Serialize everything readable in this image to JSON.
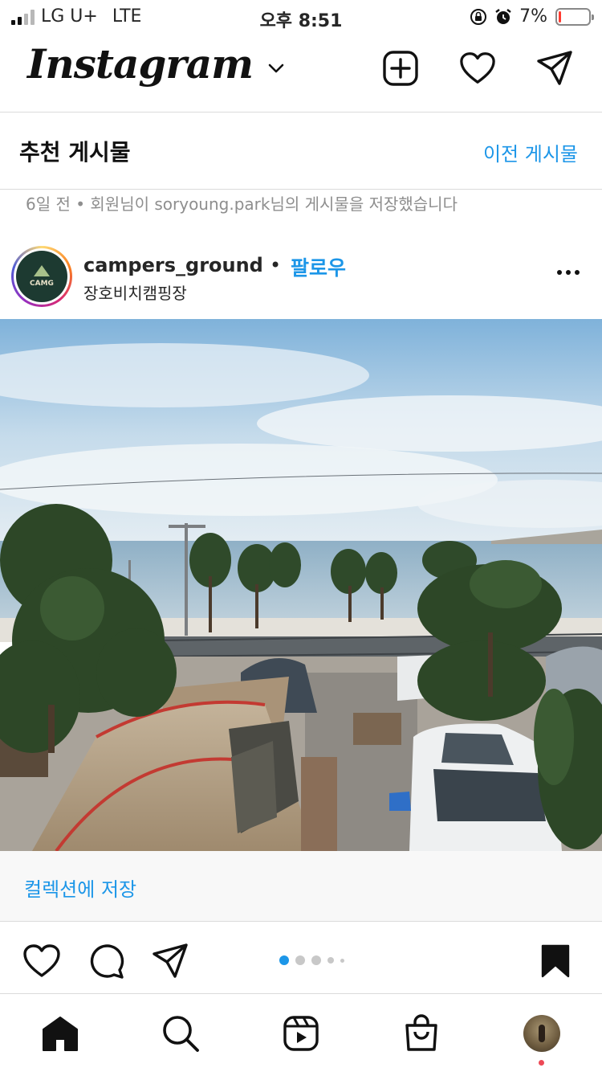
{
  "status_bar": {
    "carrier": "LG U+",
    "network": "LTE",
    "time": "오후 8:51",
    "battery_percent": "7%",
    "battery_level": 0.07,
    "signal_bars_active": 2,
    "signal_bars_total": 4
  },
  "header": {
    "logo": "Instagram",
    "icons": [
      "new-post-icon",
      "activity-heart-icon",
      "direct-message-icon"
    ]
  },
  "suggested": {
    "title": "추천 게시물",
    "previous_link": "이전 게시물"
  },
  "save_note": "6일 전 • 회원님이 soryoung.park님의 게시물을 저장했습니다",
  "post": {
    "username": "campers_ground",
    "separator": "•",
    "follow_label": "팔로우",
    "location": "장호비치캠핑장",
    "avatar_text": "CAMG",
    "carousel_dots": 5,
    "carousel_active": 0
  },
  "collection": {
    "label": "컬렉션에 저장"
  },
  "actions": {
    "icons": [
      "like-icon",
      "comment-icon",
      "share-icon",
      "bookmark-icon"
    ]
  },
  "tab_bar": {
    "icons": [
      "home-icon",
      "search-icon",
      "reels-icon",
      "shop-icon",
      "profile-avatar"
    ]
  },
  "colors": {
    "accent_blue": "#1c96e8",
    "border": "#dbdbdb",
    "muted_text": "#8e8e8e",
    "notification_red": "#ed4956"
  }
}
